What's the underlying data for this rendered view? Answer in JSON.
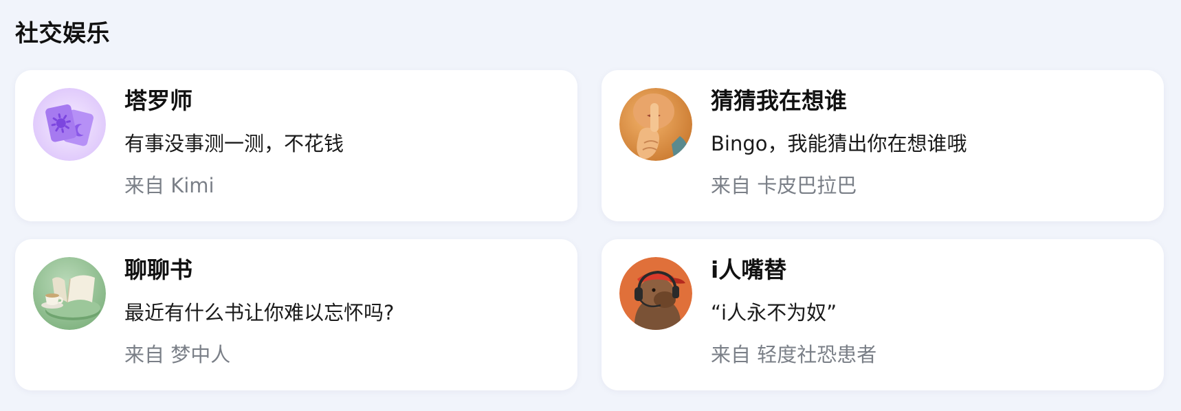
{
  "section": {
    "title": "社交娱乐"
  },
  "cards": [
    {
      "name": "塔罗师",
      "description": "有事没事测一测，不花钱",
      "author": "来自 Kimi",
      "avatar_icon": "tarot-cards-icon"
    },
    {
      "name": "猜猜我在想谁",
      "description": "Bingo，我能猜出你在想谁哦",
      "author": "来自 卡皮巴拉巴",
      "avatar_icon": "shush-gesture-icon"
    },
    {
      "name": "聊聊书",
      "description": "最近有什么书让你难以忘怀吗?",
      "author": "来自 梦中人",
      "avatar_icon": "book-and-teacup-icon"
    },
    {
      "name": "i人嘴替",
      "description": "“i人永不为奴”",
      "author": "来自 轻度社恐患者",
      "avatar_icon": "capybara-headphones-icon"
    }
  ],
  "colors": {
    "page_background": "#f1f4fb",
    "card_background": "#ffffff",
    "author_text": "#7a7f87",
    "tarot_purple": "#a67af0",
    "book_green": "#8fbc8f",
    "capybara_orange": "#e0703a"
  }
}
